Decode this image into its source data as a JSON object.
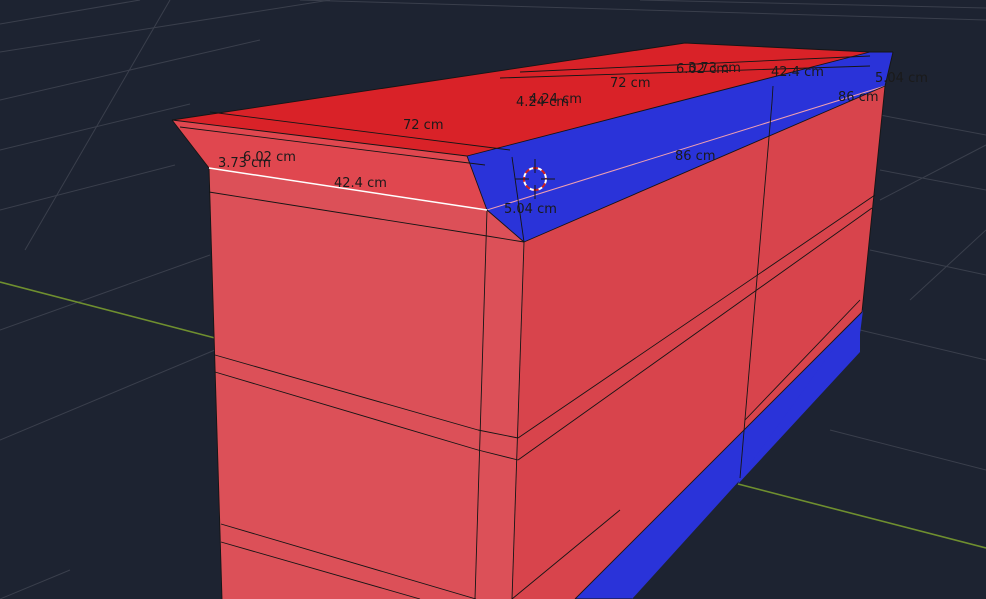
{
  "viewport": {
    "colors": {
      "background": "#1d2331",
      "grid": "#3a3f4c",
      "axis_x": "#6f8f2f",
      "face_red_front": "#dc5058",
      "face_red_side": "#d8444c",
      "face_red_top": "#d92228",
      "face_blue": "#2a33d9",
      "edge": "#151515",
      "selected_edge": "#ffffff"
    },
    "cursor_icon": "3d-cursor-icon"
  },
  "dimensions": [
    {
      "id": "top-72-left",
      "text": "72 cm"
    },
    {
      "id": "top-6.02-left",
      "text": "6.02 cm"
    },
    {
      "id": "top-3.73-left",
      "text": "3.73 cm"
    },
    {
      "id": "front-42.4",
      "text": "42.4 cm"
    },
    {
      "id": "top-4.24-a",
      "text": "4.24 cm"
    },
    {
      "id": "top-4.24-b",
      "text": "4.24 cm"
    },
    {
      "id": "top-72-right",
      "text": "72 cm"
    },
    {
      "id": "top-6.02-right",
      "text": "6.02 cm"
    },
    {
      "id": "top-3.73-right",
      "text": "3.73 cm"
    },
    {
      "id": "top-42.4-right",
      "text": "42.4 cm"
    },
    {
      "id": "top-5.04-right",
      "text": "5.04 cm"
    },
    {
      "id": "top-86-right",
      "text": "86 cm"
    },
    {
      "id": "side-86",
      "text": "86 cm"
    },
    {
      "id": "corner-5.04",
      "text": "5.04 cm"
    }
  ]
}
